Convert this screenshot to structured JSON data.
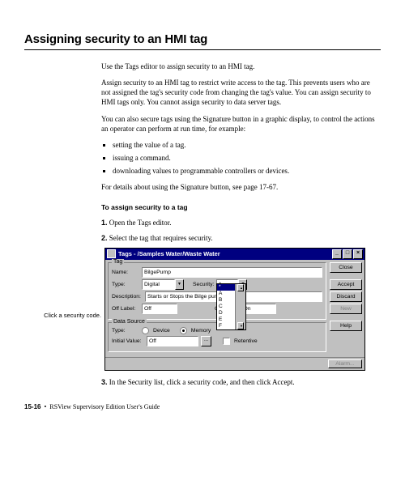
{
  "heading": "Assigning security to an HMI tag",
  "intro": "Use the Tags editor to assign security to an HMI tag.",
  "para2": "Assign security to an HMI tag to restrict write access to the tag. This prevents users who are not assigned the tag's security code from changing the tag's value. You can assign security to HMI tags only. You cannot assign security to data server tags.",
  "para3": "You can also secure tags using the Signature button in a graphic display, to control the actions an operator can perform at run time, for example:",
  "bullets": [
    "setting the value of a tag.",
    "issuing a command.",
    "downloading values to programmable controllers or devices."
  ],
  "para4": "For details about using the Signature button, see page 17-67.",
  "sub_heading": "To assign security to a tag",
  "steps": {
    "s1": "Open the Tags editor.",
    "s2": "Select the tag that requires security.",
    "s3": "In the Security list, click a security code, and then click Accept."
  },
  "callout": "Click a security code.",
  "dialog": {
    "title": "Tags - /Samples Water/Waste Water",
    "group_tag": "Tag",
    "name_label": "Name:",
    "name_value": "BilgePump",
    "type_label": "Type:",
    "type_value": "Digital",
    "security_label": "Security:",
    "security_value": "*",
    "desc_label": "Description:",
    "desc_value": "Starts or Stops the Bilge pump",
    "off_label": "Off Label:",
    "off_value": "Off",
    "on_label": "On Label:",
    "on_value": "On",
    "group_ds": "Data Source",
    "ds_type_label": "Type:",
    "ds_device": "Device",
    "ds_memory": "Memory",
    "init_label": "Initial Value:",
    "init_value": "Off",
    "retentive": "Retentive",
    "dropdown_opts": [
      "*",
      "A",
      "B",
      "C",
      "D",
      "E",
      "F"
    ],
    "buttons": {
      "close": "Close",
      "accept": "Accept",
      "discard": "Discard",
      "new": "New",
      "help": "Help",
      "alarm": "Alarm..."
    }
  },
  "footer": {
    "page": "15-16",
    "book": "RSView Supervisory Edition User's Guide"
  }
}
